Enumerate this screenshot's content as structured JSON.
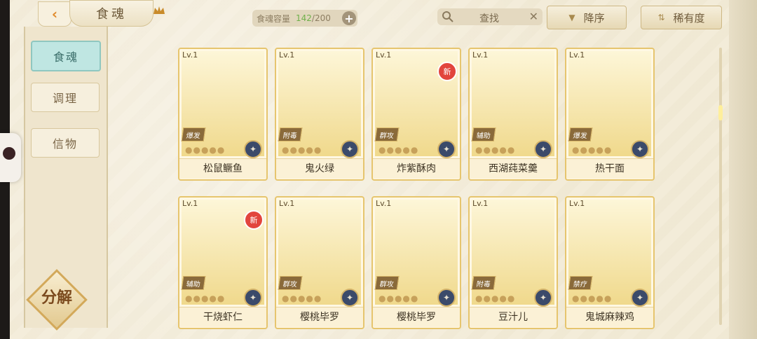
{
  "header": {
    "title": "食魂",
    "capacity": {
      "label": "食魂容量",
      "current": "142",
      "max": "/200"
    },
    "search_placeholder": "查找",
    "sort_desc_label": "降序",
    "sort_rarity_label": "稀有度"
  },
  "sidebar": {
    "tabs": [
      {
        "label": "食魂",
        "active": true
      },
      {
        "label": "调理",
        "active": false
      },
      {
        "label": "信物",
        "active": false
      }
    ],
    "decompose_label": "分解"
  },
  "cards": [
    {
      "level": "Lv.1",
      "role": "爆发",
      "name": "松鼠鳜鱼",
      "new": false,
      "stars": "●●●●●",
      "element": "✦"
    },
    {
      "level": "Lv.1",
      "role": "附毒",
      "name": "鬼火绿",
      "new": false,
      "stars": "●●●●●",
      "element": "✦"
    },
    {
      "level": "Lv.1",
      "role": "群攻",
      "name": "炸紫酥肉",
      "new": true,
      "badge": "新",
      "stars": "●●●●●",
      "element": "✦"
    },
    {
      "level": "Lv.1",
      "role": "辅助",
      "name": "西湖莼菜羹",
      "new": false,
      "stars": "●●●●●",
      "element": "✦"
    },
    {
      "level": "Lv.1",
      "role": "爆发",
      "name": "热干面",
      "new": false,
      "stars": "●●●●●",
      "element": "✦"
    },
    {
      "level": "Lv.1",
      "role": "辅助",
      "name": "干烧虾仁",
      "new": true,
      "badge": "新",
      "stars": "●●●●●",
      "element": "✦"
    },
    {
      "level": "Lv.1",
      "role": "群攻",
      "name": "樱桃毕罗",
      "new": false,
      "stars": "●●●●●",
      "element": "✦"
    },
    {
      "level": "Lv.1",
      "role": "群攻",
      "name": "樱桃毕罗",
      "new": false,
      "stars": "●●●●●",
      "element": "✦"
    },
    {
      "level": "Lv.1",
      "role": "附毒",
      "name": "豆汁儿",
      "new": false,
      "stars": "●●●●●",
      "element": "✦"
    },
    {
      "level": "Lv.1",
      "role": "禁疗",
      "name": "鬼城麻辣鸡",
      "new": false,
      "stars": "●●●●●",
      "element": "✦"
    }
  ],
  "icons": {
    "back": "chevron-left-icon",
    "crown": "crown-icon",
    "search": "search-icon",
    "clear": "close-icon",
    "plus": "plus-icon"
  },
  "colors": {
    "accent_teal": "#bfe6e2",
    "card_gold": "#e6c56e",
    "new_badge": "#e2453d",
    "capacity_current": "#6fb04a"
  }
}
